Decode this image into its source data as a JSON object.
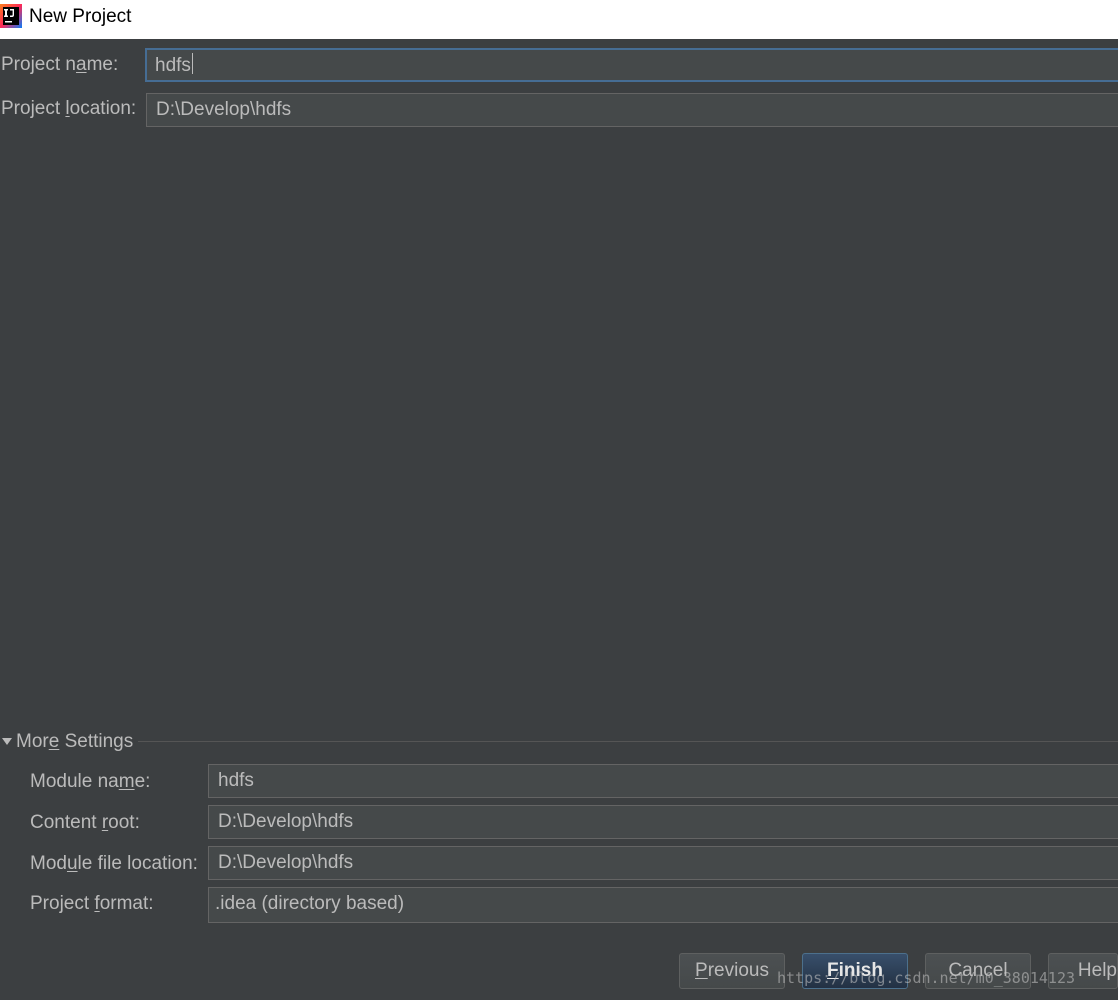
{
  "window": {
    "title": "New Project",
    "icon": "intellij-idea-icon"
  },
  "project": {
    "name_label_pre": "Project n",
    "name_label_u": "a",
    "name_label_post": "me:",
    "name_value": "hdfs",
    "location_label_pre": "Project ",
    "location_label_u": "l",
    "location_label_post": "ocation:",
    "location_value": "D:\\Develop\\hdfs"
  },
  "more_settings": {
    "label_pre": "Mor",
    "label_u": "e",
    "label_post": " Settings",
    "expanded": true,
    "module_name_label_pre": "Module na",
    "module_name_label_u": "m",
    "module_name_label_post": "e:",
    "module_name_value": "hdfs",
    "content_root_label_pre": "Content ",
    "content_root_label_u": "r",
    "content_root_label_post": "oot:",
    "content_root_value": "D:\\Develop\\hdfs",
    "module_file_label_pre": "Mod",
    "module_file_label_u": "u",
    "module_file_label_post": "le file location:",
    "module_file_value": "D:\\Develop\\hdfs",
    "format_label_pre": "Project ",
    "format_label_u": "f",
    "format_label_post": "ormat:",
    "format_value": ".idea (directory based)"
  },
  "buttons": {
    "previous_u": "P",
    "previous_rest": "revious",
    "finish_u": "F",
    "finish_rest": "inish",
    "cancel": "Cancel",
    "help": "Help"
  },
  "watermark": "https://blog.csdn.net/m0_38014123",
  "colors": {
    "background": "#3c3f41",
    "field_background": "#45494a",
    "text": "#bbbbbb",
    "focus_border": "#466d94",
    "default_button": "#2b3f5a"
  }
}
